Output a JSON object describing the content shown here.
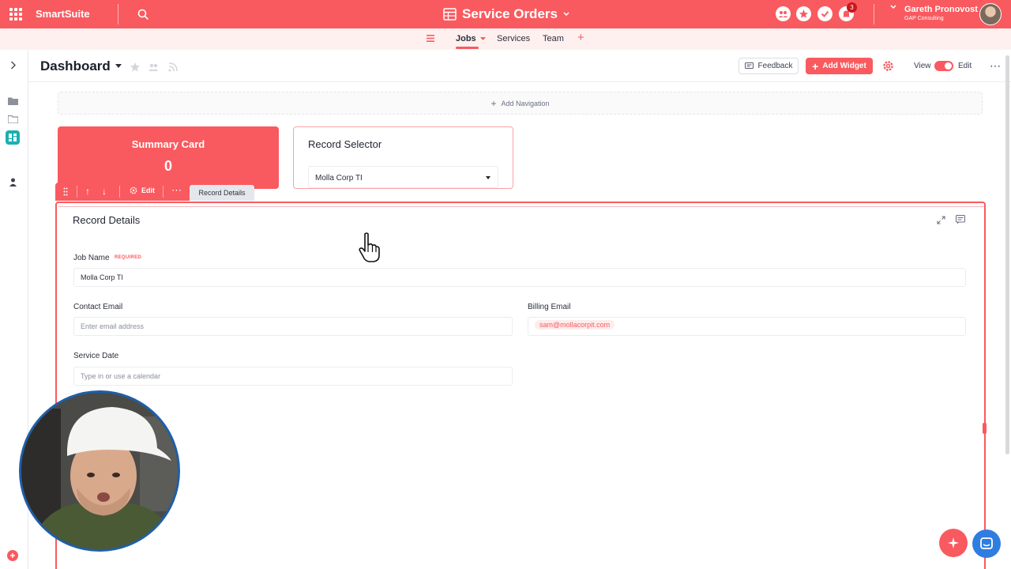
{
  "app": {
    "brand": "SmartSuite",
    "title": "Service Orders"
  },
  "notifications": {
    "count": "3"
  },
  "user": {
    "name": "Gareth Pronovost",
    "org": "GAP Consulting"
  },
  "nav": {
    "tabs": [
      {
        "label": "Jobs"
      },
      {
        "label": "Services"
      },
      {
        "label": "Team"
      }
    ]
  },
  "dashboard": {
    "title": "Dashboard",
    "feedback_label": "Feedback",
    "add_widget_label": "Add Widget",
    "view_label": "View",
    "edit_label": "Edit",
    "add_navigation_label": "Add Navigation"
  },
  "summary_card": {
    "title": "Summary Card",
    "value": "0"
  },
  "record_selector": {
    "title": "Record Selector",
    "selected": "Molla Corp TI"
  },
  "widget_toolbar": {
    "edit_label": "Edit",
    "tab_label": "Record Details"
  },
  "record_details": {
    "title": "Record Details",
    "job_name": {
      "label": "Job Name",
      "required": "REQUIRED",
      "value": "Molla Corp TI"
    },
    "contact_email": {
      "label": "Contact Email",
      "placeholder": "Enter email address"
    },
    "billing_email": {
      "label": "Billing Email",
      "value": "sam@mollacorpit.com"
    },
    "service_date": {
      "label": "Service Date",
      "placeholder": "Type in or use a calendar"
    }
  },
  "colors": {
    "accent": "#f95a5f",
    "teal": "#1ab0b0",
    "chat": "#2f7de1"
  }
}
